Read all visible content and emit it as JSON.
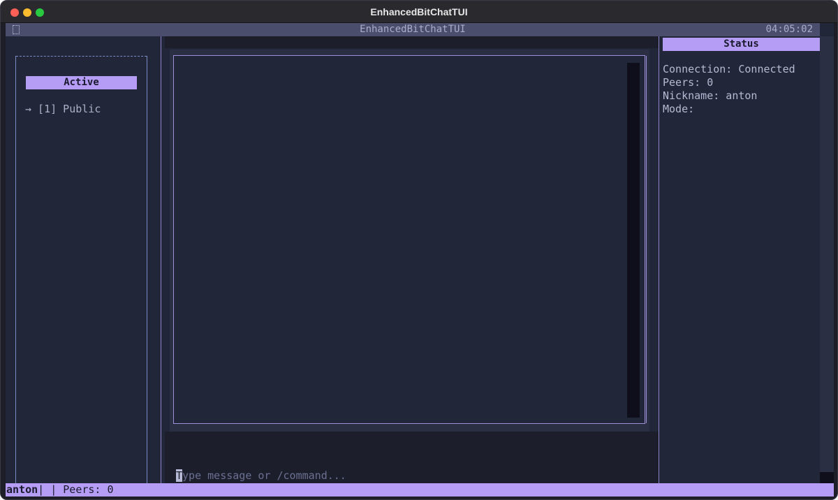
{
  "window": {
    "title": "EnhancedBitChatTUI"
  },
  "header": {
    "title": "EnhancedBitChatTUI",
    "clock": "04:05:02"
  },
  "channels": {
    "label": "Active",
    "items": [
      {
        "text": "→ [1] Public"
      }
    ]
  },
  "input": {
    "placeholder_rest": "ype message or /command...",
    "cursor_char": "T"
  },
  "status": {
    "label": "Status",
    "connection": "Connection: Connected",
    "peers": "Peers: 0",
    "nickname": "Nickname: anton",
    "mode": "Mode:"
  },
  "footer": {
    "nick": "anton",
    "sep": "|  | ",
    "peers": "Peers: 0"
  },
  "colors": {
    "accent": "#b59cf5",
    "background": "#222639",
    "header": "#4a4e6c"
  }
}
